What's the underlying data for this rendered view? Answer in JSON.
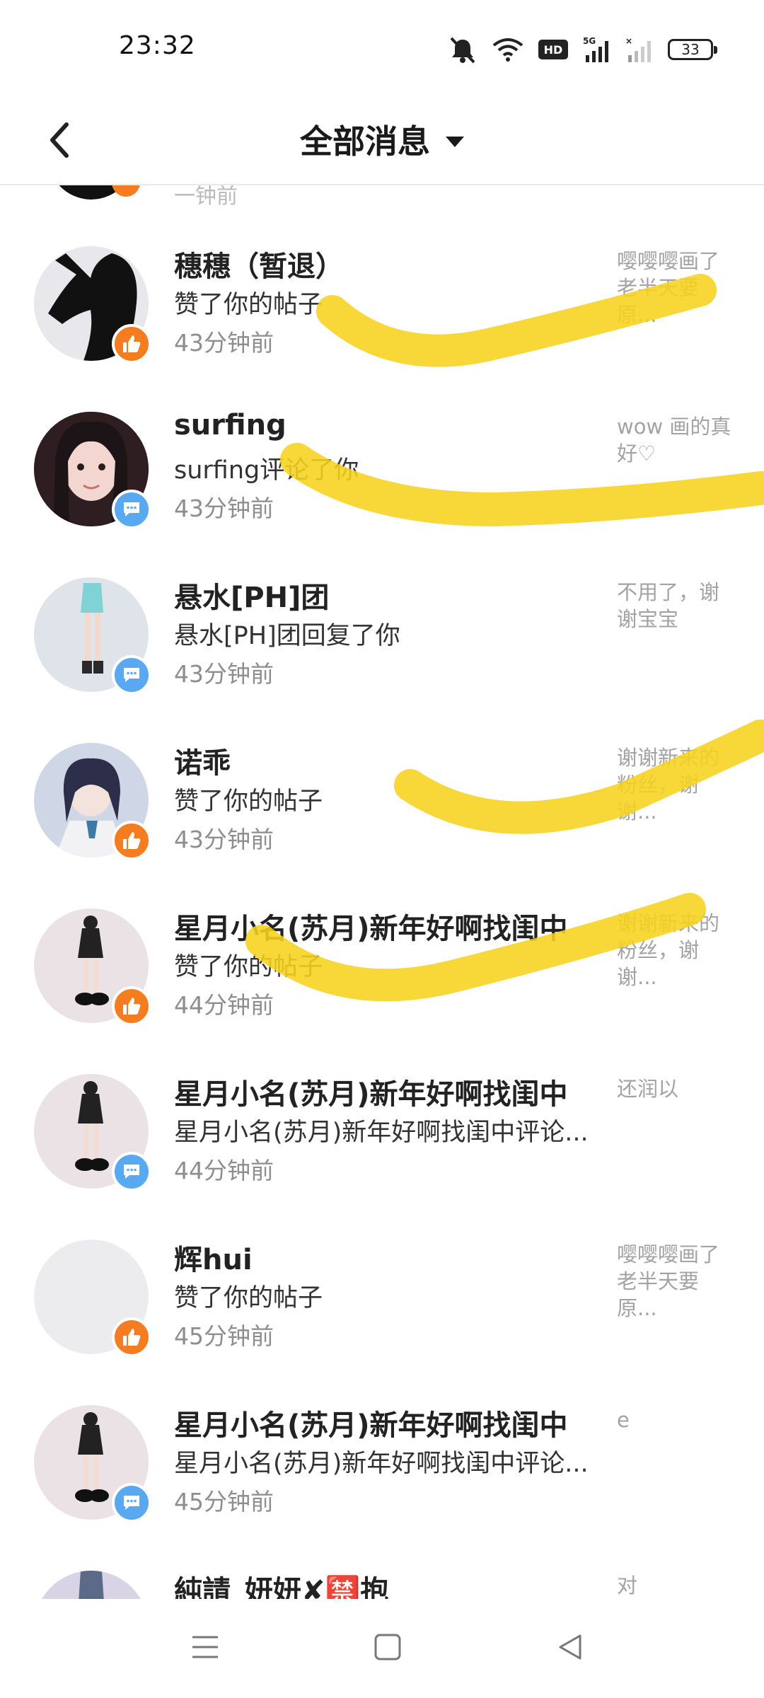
{
  "status_bar": {
    "time": "23:32",
    "battery": "33"
  },
  "header": {
    "title": "全部消息"
  },
  "partial_top_item": {
    "time_fragment": "一钟前"
  },
  "items": [
    {
      "name": "穗穗（暂退）",
      "action": "赞了你的帖子",
      "time": "43分钟前",
      "type": "like",
      "preview": "嘤嘤嘤画了老半天要原..."
    },
    {
      "name": "surfing",
      "action": "surfing评论了你",
      "time": "43分钟前",
      "type": "comment",
      "preview": "wow 画的真好♡"
    },
    {
      "name": "悬水[PH]团",
      "action": "悬水[PH]团回复了你",
      "time": "43分钟前",
      "type": "comment",
      "preview": "不用了，谢谢宝宝"
    },
    {
      "name": "诺乖",
      "action": "赞了你的帖子",
      "time": "43分钟前",
      "type": "like",
      "preview": "谢谢新来的粉丝，谢谢..."
    },
    {
      "name": "星月小名(苏月)新年好啊找闺中",
      "action": "赞了你的帖子",
      "time": "44分钟前",
      "type": "like",
      "preview": "谢谢新来的粉丝，谢谢..."
    },
    {
      "name": "星月小名(苏月)新年好啊找闺中",
      "action": "星月小名(苏月)新年好啊找闺中评论...",
      "time": "44分钟前",
      "type": "comment",
      "preview": "还润以"
    },
    {
      "name": "辉hui",
      "action": "赞了你的帖子",
      "time": "45分钟前",
      "type": "like",
      "preview": "嘤嘤嘤画了老半天要原..."
    },
    {
      "name": "星月小名(苏月)新年好啊找闺中",
      "action": "星月小名(苏月)新年好啊找闺中评论...",
      "time": "45分钟前",
      "type": "comment",
      "preview": "e"
    },
    {
      "name": "純請_妍妍✘🈲抱",
      "action": "",
      "time": "",
      "type": "like",
      "preview": "对"
    }
  ],
  "colors": {
    "like_badge": "#f57c1f",
    "comment_badge": "#58a8f2",
    "scribble": "#f7d21e"
  },
  "icons": {
    "back": "chevron-left-icon",
    "dropdown": "caret-down-icon",
    "like": "thumbs-up-icon",
    "comment": "chat-bubble-icon",
    "nav": [
      "menu-icon",
      "home-square-icon",
      "back-triangle-icon"
    ]
  }
}
